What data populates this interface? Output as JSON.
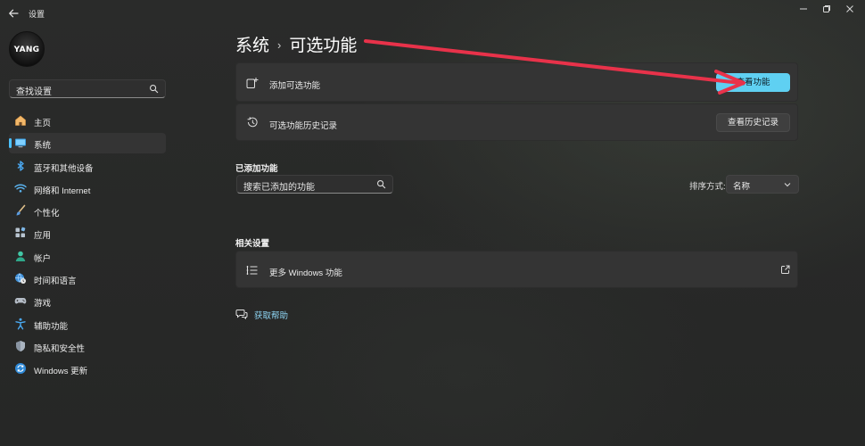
{
  "window": {
    "title": "设置"
  },
  "user": {
    "avatar_text": "YANG"
  },
  "sidebar": {
    "search_placeholder": "查找设置",
    "items": [
      {
        "label": "主页",
        "icon": "home-icon"
      },
      {
        "label": "系统",
        "icon": "system-icon",
        "active": true
      },
      {
        "label": "蓝牙和其他设备",
        "icon": "bluetooth-icon"
      },
      {
        "label": "网络和 Internet",
        "icon": "wifi-icon"
      },
      {
        "label": "个性化",
        "icon": "brush-icon"
      },
      {
        "label": "应用",
        "icon": "apps-icon"
      },
      {
        "label": "帐户",
        "icon": "account-icon"
      },
      {
        "label": "时间和语言",
        "icon": "globe-clock-icon"
      },
      {
        "label": "游戏",
        "icon": "gamepad-icon"
      },
      {
        "label": "辅助功能",
        "icon": "accessibility-icon"
      },
      {
        "label": "隐私和安全性",
        "icon": "shield-icon"
      },
      {
        "label": "Windows 更新",
        "icon": "update-icon"
      }
    ]
  },
  "main": {
    "breadcrumb": {
      "parent": "系统",
      "separator": "›",
      "current": "可选功能"
    },
    "add_feature": {
      "label": "添加可选功能",
      "button": "查看功能"
    },
    "history": {
      "label": "可选功能历史记录",
      "button": "查看历史记录"
    },
    "added": {
      "title": "已添加功能",
      "search_placeholder": "搜索已添加的功能",
      "sort_label": "排序方式:",
      "sort_value": "名称"
    },
    "related": {
      "title": "相关设置",
      "more_windows_features": "更多 Windows 功能"
    },
    "help": {
      "label": "获取帮助"
    }
  },
  "colors": {
    "accent": "#5fd0f2",
    "annotation_arrow": "#e8324a",
    "background": "#272727",
    "card": "#343434"
  }
}
